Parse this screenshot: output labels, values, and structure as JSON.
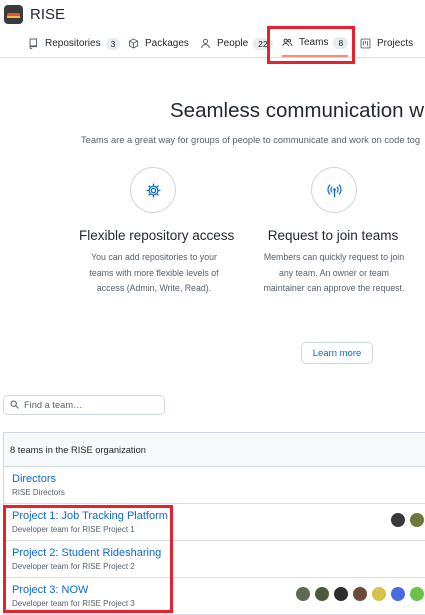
{
  "org": {
    "name": "RISE"
  },
  "tabs": [
    {
      "label": "Repositories",
      "counter": "3",
      "icon": "repo-icon"
    },
    {
      "label": "Packages",
      "icon": "package-icon"
    },
    {
      "label": "People",
      "counter": "22",
      "icon": "person-icon"
    },
    {
      "label": "Teams",
      "counter": "8",
      "icon": "people-icon",
      "active": true
    },
    {
      "label": "Projects",
      "icon": "project-icon"
    }
  ],
  "blank_slate": {
    "title": "Seamless communication wit",
    "subtitle": "Teams are a great way for groups of people to communicate and work on code tog",
    "features": [
      {
        "icon": "gear-icon",
        "title": "Flexible repository access",
        "desc_lines": [
          "You can add repositories to your",
          "teams with more flexible levels of",
          "access (Admin, Write, Read)."
        ]
      },
      {
        "icon": "broadcast-icon",
        "title": "Request to join teams",
        "desc_lines": [
          "Members can quickly request to join",
          "any team. An owner or team",
          "maintainer can approve the request."
        ]
      }
    ],
    "learn_more": "Learn more"
  },
  "search": {
    "placeholder": "Find a team…",
    "value": ""
  },
  "team_list": {
    "header": "8 teams in the RISE organization",
    "teams": [
      {
        "name": "Directors",
        "description": "RISE Directors",
        "members": []
      },
      {
        "name": "Project 1: Job Tracking Platform",
        "description": "Developer team for RISE Project 1",
        "members": [
          "#3a3a3a",
          "#6b7a3a"
        ]
      },
      {
        "name": "Project 2: Student Ridesharing",
        "description": "Developer team for RISE Project 2",
        "members": []
      },
      {
        "name": "Project 3: NOW",
        "description": "Developer team for RISE Project 3",
        "members": [
          "#5c6b52",
          "#4a5a3a",
          "#2e2e2e",
          "#6b4a3a",
          "#d4c24a",
          "#4a6be0",
          "#6bc24a"
        ]
      }
    ]
  },
  "colors": {
    "accent": "#0969da",
    "highlight": "#e5222d",
    "active_tab_underline": "#fd8c73"
  }
}
